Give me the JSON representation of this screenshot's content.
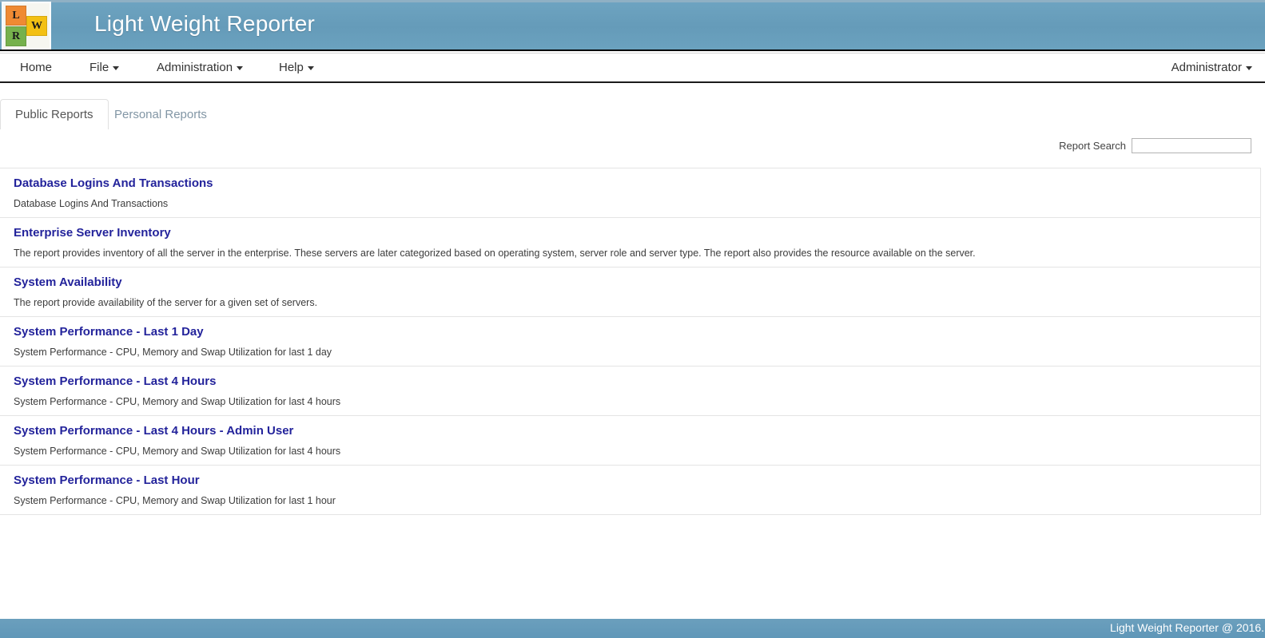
{
  "header": {
    "title": "Light Weight Reporter",
    "logo": {
      "tile_l": "L",
      "tile_r": "R",
      "tile_w": "W"
    },
    "colors": {
      "header_blue": "#6ba0bf",
      "logo_orange": "#ef8a33",
      "logo_green": "#76b14c",
      "logo_yellow": "#f3c013",
      "link_navy": "#23239b"
    }
  },
  "nav": {
    "items": [
      {
        "label": "Home",
        "has_caret": false
      },
      {
        "label": "File",
        "has_caret": true
      },
      {
        "label": "Administration",
        "has_caret": true
      },
      {
        "label": "Help",
        "has_caret": true
      }
    ],
    "user": {
      "label": "Administrator",
      "has_caret": true
    }
  },
  "tabs": [
    {
      "label": "Public Reports",
      "active": true
    },
    {
      "label": "Personal Reports",
      "active": false
    }
  ],
  "search": {
    "label": "Report Search",
    "value": "",
    "placeholder": ""
  },
  "reports": [
    {
      "title": "Database Logins And Transactions",
      "description": "Database Logins And Transactions"
    },
    {
      "title": "Enterprise Server Inventory",
      "description": "The report provides inventory of all the server in the enterprise. These servers are later categorized based on operating system, server role and server type. The report also provides the resource available on the server."
    },
    {
      "title": "System Availability",
      "description": "The report provide availability of the server for a given set of servers."
    },
    {
      "title": "System Performance - Last 1 Day",
      "description": "System Performance - CPU, Memory and Swap Utilization for last 1 day"
    },
    {
      "title": "System Performance - Last 4 Hours",
      "description": "System Performance - CPU, Memory and Swap Utilization for last 4 hours"
    },
    {
      "title": "System Performance - Last 4 Hours - Admin User",
      "description": "System Performance - CPU, Memory and Swap Utilization for last 4 hours"
    },
    {
      "title": "System Performance - Last Hour",
      "description": "System Performance - CPU, Memory and Swap Utilization for last 1 hour"
    }
  ],
  "footer": {
    "text": "Light Weight Reporter @ 2016."
  }
}
